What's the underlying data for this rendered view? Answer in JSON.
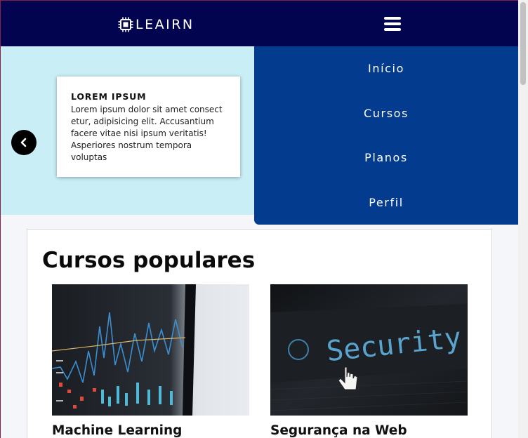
{
  "brand": {
    "name": "LEAIRN",
    "logo_icon": "cpu-chip-icon"
  },
  "navbar": {
    "menu_icon": "hamburger-icon",
    "background": "#03044f"
  },
  "hero": {
    "background": "#c9eef6",
    "card_title": "LOREM IPSUM",
    "card_text": "Lorem ipsum dolor sit amet consect etur, adipisicing elit. Accusantium facere vitae nisi ipsum veritatis! Asperiores nostrum tempora voluptas",
    "prev_icon": "chevron-left-icon"
  },
  "menu": {
    "background": "#033b8f",
    "items": [
      {
        "label": "Início"
      },
      {
        "label": "Cursos"
      },
      {
        "label": "Planos"
      },
      {
        "label": "Perfil"
      }
    ]
  },
  "popular": {
    "heading": "Cursos populares",
    "courses": [
      {
        "title": "Machine Learning",
        "image": "stock-chart-image"
      },
      {
        "title": "Segurança na Web",
        "image": "security-screen-image"
      }
    ]
  }
}
